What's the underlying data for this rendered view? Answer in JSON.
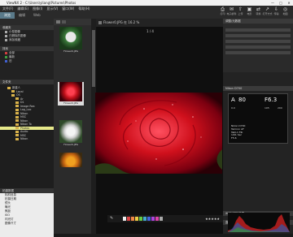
{
  "title": "ViewNX 2 - C:\\Users\\yliang\\Pictures\\Photos",
  "window_controls": [
    "—",
    "□",
    "✕"
  ],
  "menu": [
    "文件(F)",
    "编辑(E)",
    "图像(I)",
    "显示(V)",
    "窗口(W)",
    "帮助(H)"
  ],
  "tabs": [
    {
      "label": "浏览",
      "active": true
    },
    {
      "label": "编辑",
      "active": false
    },
    {
      "label": "Web",
      "active": false
    }
  ],
  "toolbar": [
    {
      "icon": "print-icon",
      "label": "打印"
    },
    {
      "icon": "mail-icon",
      "label": "电子邮件"
    },
    {
      "icon": "upload-icon",
      "label": "上传"
    },
    {
      "icon": "film-icon",
      "label": "电影"
    },
    {
      "icon": "convert-icon",
      "label": "转换"
    },
    {
      "icon": "open-icon",
      "label": "打开方式"
    },
    {
      "icon": "transfer-icon",
      "label": "传输"
    },
    {
      "icon": "map-icon",
      "label": "地图"
    }
  ],
  "left": {
    "fav_section": "收藏夹",
    "fav_items": [
      "小型图像",
      "已删除的图像",
      "添加收藏"
    ],
    "sort_section": "排序",
    "sort_items": [
      {
        "label": "全部",
        "color": "#d04040"
      },
      {
        "label": "最新",
        "color": "#40a040"
      },
      {
        "label": "旧",
        "color": "#4060d0"
      }
    ],
    "folder_section": "文件夹",
    "folders": [
      {
        "label": "新建人",
        "indent": 1,
        "sel": false
      },
      {
        "label": "Local",
        "indent": 2,
        "sel": false
      },
      {
        "label": "OS",
        "indent": 2,
        "sel": false
      },
      {
        "label": "Ar",
        "indent": 3,
        "sel": false
      },
      {
        "label": "D1",
        "indent": 3,
        "sel": false
      },
      {
        "label": "Image Rea",
        "indent": 3,
        "sel": false
      },
      {
        "label": "Log_Loo",
        "indent": 3,
        "sel": false
      },
      {
        "label": "Nikon",
        "indent": 3,
        "sel": false
      },
      {
        "label": "MSC",
        "indent": 3,
        "sel": false
      },
      {
        "label": "Nikon",
        "indent": 3,
        "sel": false
      },
      {
        "label": "Nikon To",
        "indent": 3,
        "sel": false
      },
      {
        "label": "Photos",
        "indent": 3,
        "sel": true
      },
      {
        "label": "Audio",
        "indent": 3,
        "sel": false
      },
      {
        "label": "MSC",
        "indent": 3,
        "sel": false
      },
      {
        "label": "Nikon",
        "indent": 3,
        "sel": false
      }
    ],
    "meta_section": "拍摄数据",
    "meta_items": [
      "相机信息",
      "拍摄日期",
      "镜头",
      "曝光",
      "焦距",
      "ISO",
      "闪光灯",
      "图像尺寸"
    ]
  },
  "filmstrip": {
    "thumbs": [
      {
        "caption": "Flower0.JPG",
        "sel": false
      },
      {
        "caption": "Flower0.JPG",
        "sel": true
      },
      {
        "caption": "Flower0.JPG",
        "sel": false
      },
      {
        "caption": "",
        "sel": false
      }
    ]
  },
  "viewer": {
    "file": "Flower0.JPG 在 16.2 %",
    "counter": "1 / 4",
    "stars": "★★★★★"
  },
  "right": {
    "adjust_title": "调整/元数据",
    "info_title": "Nikon D700",
    "exposure": {
      "mode": "A",
      "shutter": "80",
      "aperture": "F6.3",
      "ev": "0.0",
      "iso": "105",
      "focal": "200"
    },
    "camera_info": [
      "Nikon D700",
      "Tamron AF",
      "Tabl-1 Flb",
      "1/61 Sec",
      "F5.6",
      "Tab/Tab8F",
      "Flower0.JPG"
    ],
    "xmp_title": "XMP/IPTC信息",
    "histo_title": "直方图"
  },
  "colors": {
    "rose_dark": "#4a0008",
    "rose_red": "#d0101c",
    "rose_light": "#ff4452",
    "leaf": "#2a3a16"
  }
}
